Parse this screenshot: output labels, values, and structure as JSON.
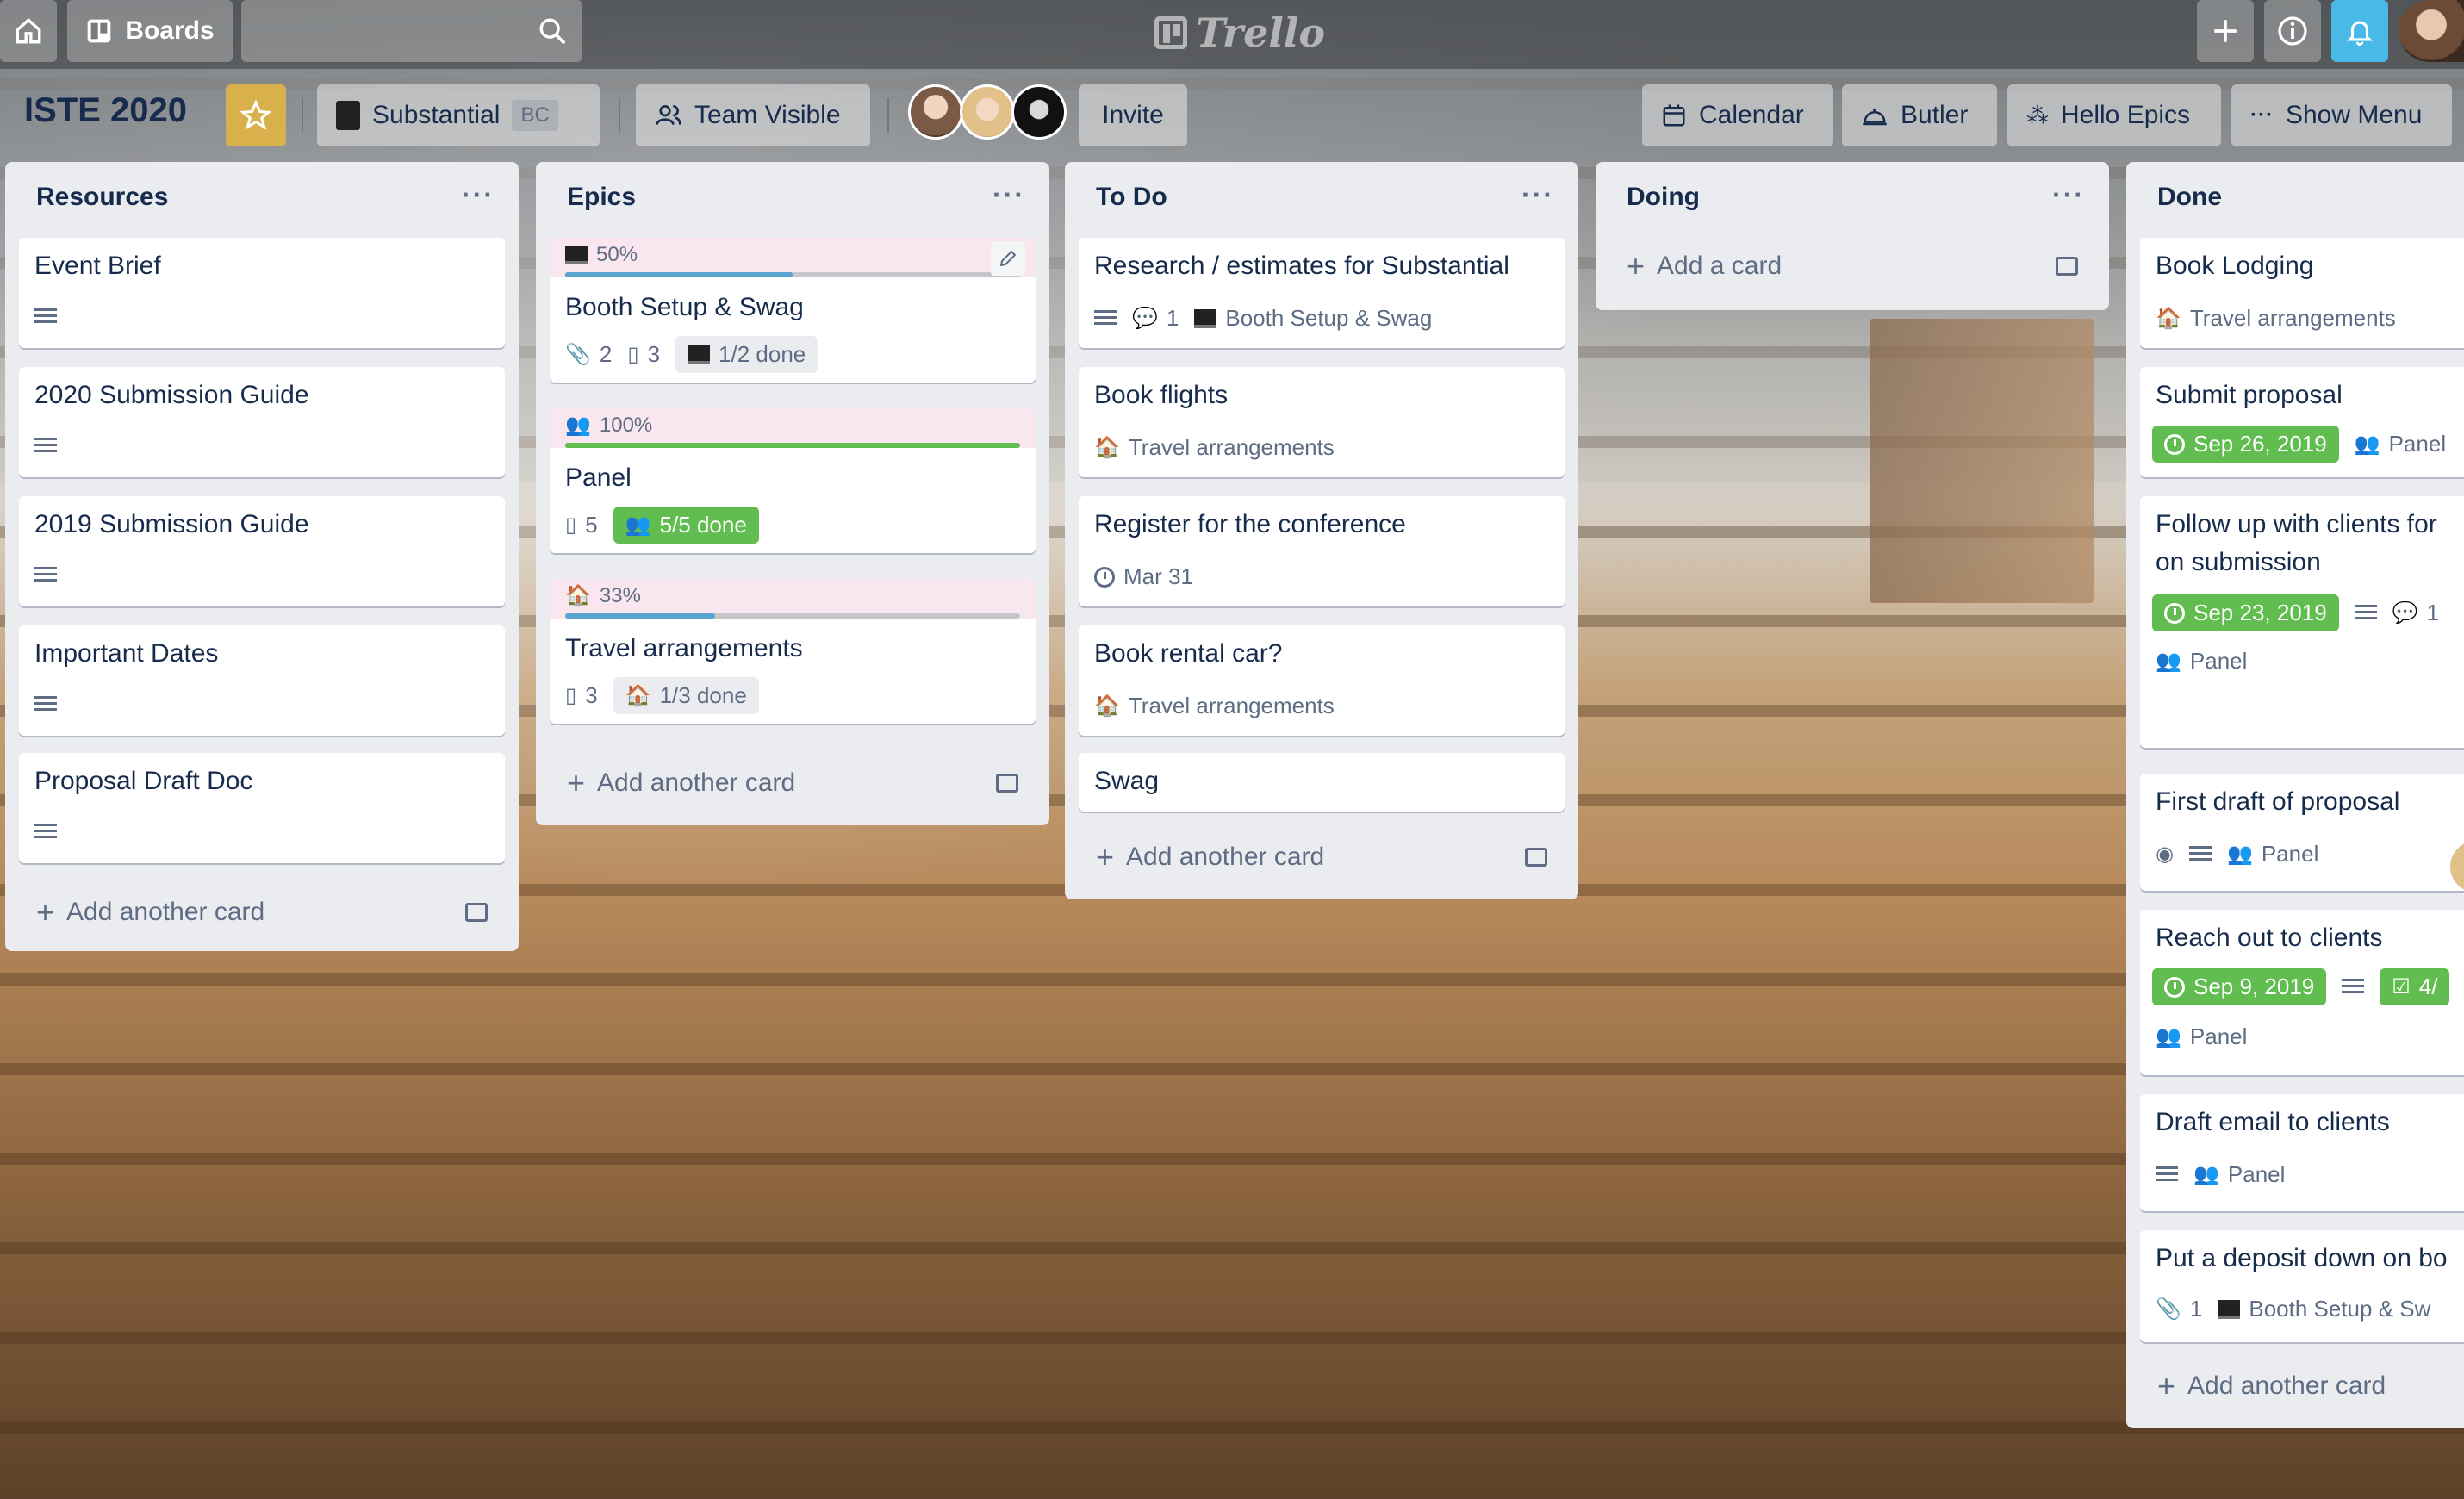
{
  "topbar": {
    "boards_label": "Boards",
    "search_placeholder": "",
    "logo_text": "Trello"
  },
  "board": {
    "title": "ISTE 2020",
    "team_name": "Substantial",
    "team_badge": "BC",
    "visibility": "Team Visible",
    "invite": "Invite",
    "calendar": "Calendar",
    "butler": "Butler",
    "hello_epics": "Hello Epics",
    "show_menu": "Show Menu"
  },
  "lists": {
    "resources": {
      "title": "Resources",
      "cards": [
        "Event Brief",
        "2020 Submission Guide",
        "2019 Submission Guide",
        "Important Dates",
        "Proposal Draft Doc"
      ],
      "add": "Add another card"
    },
    "epics": {
      "title": "Epics",
      "cards": [
        {
          "progress": "50%",
          "progress_value": 0.5,
          "title": "Booth Setup & Swag",
          "attachments": "2",
          "cards": "3",
          "done": "1/2 done"
        },
        {
          "progress": "100%",
          "progress_value": 1.0,
          "title": "Panel",
          "cards": "5",
          "done": "5/5 done"
        },
        {
          "progress": "33%",
          "progress_value": 0.33,
          "title": "Travel arrangements",
          "cards": "3",
          "done": "1/3 done"
        }
      ],
      "add": "Add another card"
    },
    "todo": {
      "title": "To Do",
      "cards": [
        {
          "title": "Research / estimates for Substantial",
          "comments": "1",
          "epic": "Booth Setup & Swag"
        },
        {
          "title": "Book flights",
          "epic": "Travel arrangements"
        },
        {
          "title": "Register for the conference",
          "due": "Mar 31"
        },
        {
          "title": "Book rental car?",
          "epic": "Travel arrangements"
        },
        {
          "title": "Swag"
        }
      ],
      "add": "Add another card"
    },
    "doing": {
      "title": "Doing",
      "add": "Add a card"
    },
    "done": {
      "title": "Done",
      "cards": [
        {
          "title": "Book Lodging",
          "epic": "Travel arrangements"
        },
        {
          "title": "Submit proposal",
          "due": "Sep 26, 2019",
          "epic": "Panel"
        },
        {
          "title_line1": "Follow up with clients for",
          "title_line2": "on submission",
          "due": "Sep 23, 2019",
          "comments": "1",
          "epic": "Panel"
        },
        {
          "title": "First draft of proposal",
          "epic": "Panel"
        },
        {
          "title": "Reach out to clients",
          "due": "Sep 9, 2019",
          "checklist": "4/",
          "epic": "Panel"
        },
        {
          "title": "Draft email to clients",
          "epic": "Panel"
        },
        {
          "title": "Put a deposit down on bo",
          "attachments": "1",
          "epic": "Booth Setup & Sw"
        }
      ],
      "add": "Add another card"
    }
  },
  "colors": {
    "green": "#61bd4f",
    "blue_progress": "#5ba4cf",
    "pink_band": "#f9e6ef",
    "notification": "#49b9e8"
  }
}
